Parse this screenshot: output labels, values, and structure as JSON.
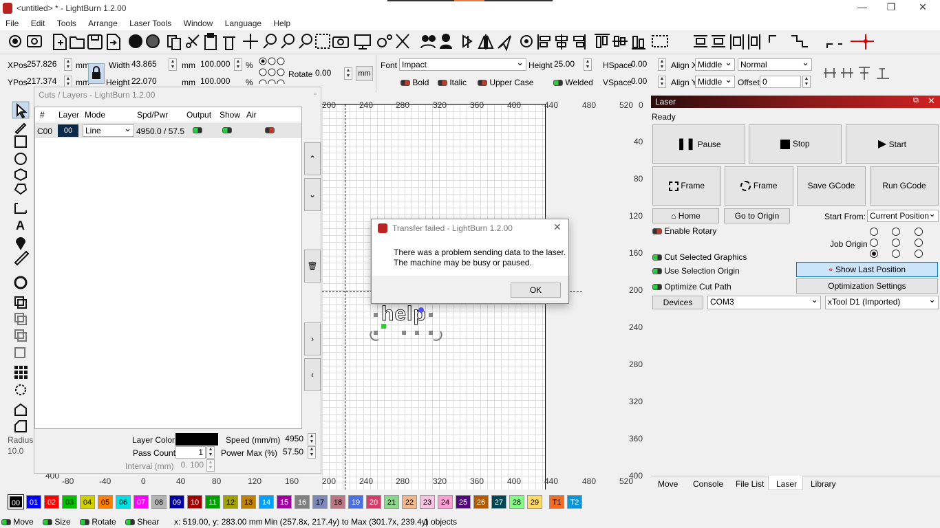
{
  "window": {
    "title": "<untitled> * - LightBurn 1.2.00",
    "min": "—",
    "max": "❐",
    "close": "✕"
  },
  "menu": [
    "File",
    "Edit",
    "Tools",
    "Arrange",
    "Laser Tools",
    "Window",
    "Language",
    "Help"
  ],
  "props": {
    "xpos_label": "XPos",
    "xpos": "257.826",
    "ypos_label": "YPos",
    "ypos": "217.374",
    "unit": "mm",
    "width_label": "Width",
    "width": "43.865",
    "height_label": "Height",
    "height": "22.070",
    "scale_w": "100.000",
    "scale_h": "100.000",
    "pct": "%",
    "rotate_label": "Rotate",
    "rotate": "0.00",
    "mm_btn": "mm",
    "font_label": "Font",
    "font": "Impact",
    "fheight_label": "Height",
    "fheight": "25.00",
    "hspace_label": "HSpace",
    "hspace": "0.00",
    "vspace_label": "VSpace",
    "vspace": "0.00",
    "alignx_label": "Align X",
    "alignx": "Middle",
    "aligny_label": "Align Y",
    "aligny": "Middle",
    "mode": "Normal",
    "offset_label": "Offset",
    "offset": "0",
    "bold": "Bold",
    "italic": "Italic",
    "upper": "Upper Case",
    "welded": "Welded"
  },
  "layers": {
    "title": "Cuts / Layers - LightBurn 1.2.00",
    "headers": [
      "#",
      "Layer",
      "Mode",
      "Spd/Pwr",
      "Output",
      "Show",
      "Air"
    ],
    "row": {
      "num": "C00",
      "layer": "00",
      "mode": "Line",
      "spdpwr": "4950.0 / 57.5"
    },
    "layer_color_label": "Layer Color",
    "speed_label": "Speed (mm/m)",
    "speed": "4950",
    "pass_label": "Pass Count",
    "pass": "1",
    "power_label": "Power Max (%)",
    "power": "57.50",
    "interval_label": "Interval (mm)",
    "interval": "0. 100"
  },
  "left": {
    "radius_label": "Radius:",
    "radius": "10.0"
  },
  "axis": {
    "top": [
      "200",
      "240",
      "280",
      "320",
      "360",
      "400",
      "440",
      "480",
      "520"
    ],
    "bottom": [
      "-80",
      "-40",
      "0",
      "40",
      "80",
      "120",
      "160",
      "200",
      "240",
      "280",
      "320",
      "360",
      "400",
      "440",
      "480",
      "520"
    ],
    "right": [
      "0",
      "40",
      "80",
      "120",
      "160",
      "200",
      "240",
      "280",
      "320",
      "360",
      "400"
    ],
    "left_400": "400"
  },
  "canvas_text": "help",
  "dialog": {
    "title": "Transfer failed - LightBurn 1.2.00",
    "line1": "There was a problem sending data to the laser.",
    "line2": "The machine may be busy or paused.",
    "ok": "OK"
  },
  "laser": {
    "title": "Laser",
    "status": "Ready",
    "pause": "Pause",
    "stop": "Stop",
    "start": "Start",
    "frame1": "Frame",
    "frame2": "Frame",
    "save_gcode": "Save GCode",
    "run_gcode": "Run GCode",
    "home": "Home",
    "go_origin": "Go to Origin",
    "start_from_label": "Start From:",
    "start_from": "Current Position",
    "enable_rotary": "Enable Rotary",
    "job_origin": "Job Origin",
    "cut_selected": "Cut Selected Graphics",
    "use_selection": "Use Selection Origin",
    "show_last": "Show Last Position",
    "optimize": "Optimize Cut Path",
    "opt_settings": "Optimization Settings",
    "devices": "Devices",
    "port": "COM3",
    "device": "xTool D1 (Imported)",
    "tabs": [
      "Move",
      "Console",
      "File List",
      "Laser",
      "Library"
    ]
  },
  "palette": [
    {
      "l": "00",
      "c": "#000000",
      "t": "#fff"
    },
    {
      "l": "01",
      "c": "#0000ff",
      "t": "#fff"
    },
    {
      "l": "02",
      "c": "#ff0000",
      "t": "#fff"
    },
    {
      "l": "03",
      "c": "#00c000",
      "t": "#000"
    },
    {
      "l": "04",
      "c": "#d0d000",
      "t": "#000"
    },
    {
      "l": "05",
      "c": "#ff8000",
      "t": "#000"
    },
    {
      "l": "06",
      "c": "#00e0e0",
      "t": "#000"
    },
    {
      "l": "07",
      "c": "#ff00ff",
      "t": "#fff"
    },
    {
      "l": "08",
      "c": "#b4b4b4",
      "t": "#000"
    },
    {
      "l": "09",
      "c": "#0000a0",
      "t": "#fff"
    },
    {
      "l": "10",
      "c": "#a00000",
      "t": "#fff"
    },
    {
      "l": "11",
      "c": "#00a000",
      "t": "#fff"
    },
    {
      "l": "12",
      "c": "#a0a000",
      "t": "#000"
    },
    {
      "l": "13",
      "c": "#c08000",
      "t": "#000"
    },
    {
      "l": "14",
      "c": "#00a0ff",
      "t": "#fff"
    },
    {
      "l": "15",
      "c": "#a000a0",
      "t": "#fff"
    },
    {
      "l": "16",
      "c": "#808080",
      "t": "#fff"
    },
    {
      "l": "17",
      "c": "#7d87b9",
      "t": "#000"
    },
    {
      "l": "18",
      "c": "#bb7784",
      "t": "#000"
    },
    {
      "l": "19",
      "c": "#4a6fe3",
      "t": "#fff"
    },
    {
      "l": "20",
      "c": "#d33f6a",
      "t": "#fff"
    },
    {
      "l": "21",
      "c": "#8cd78c",
      "t": "#000"
    },
    {
      "l": "22",
      "c": "#f0b98d",
      "t": "#000"
    },
    {
      "l": "23",
      "c": "#f6c4e1",
      "t": "#000"
    },
    {
      "l": "24",
      "c": "#fa9ed4",
      "t": "#000"
    },
    {
      "l": "25",
      "c": "#500a78",
      "t": "#fff"
    },
    {
      "l": "26",
      "c": "#b45a00",
      "t": "#fff"
    },
    {
      "l": "27",
      "c": "#004754",
      "t": "#fff"
    },
    {
      "l": "28",
      "c": "#86fa88",
      "t": "#000"
    },
    {
      "l": "29",
      "c": "#ffdb66",
      "t": "#000"
    },
    {
      "l": "T1",
      "c": "#f36926",
      "t": "#000"
    },
    {
      "l": "T2",
      "c": "#0c96d9",
      "t": "#fff"
    }
  ],
  "statusbar": {
    "move": "Move",
    "size": "Size",
    "rotate": "Rotate",
    "shear": "Shear",
    "coords": "x: 519.00, y: 283.00 mm",
    "bounds": "Min (257.8x, 217.4y) to Max (301.7x, 239.4y)",
    "objects": "1 objects"
  }
}
